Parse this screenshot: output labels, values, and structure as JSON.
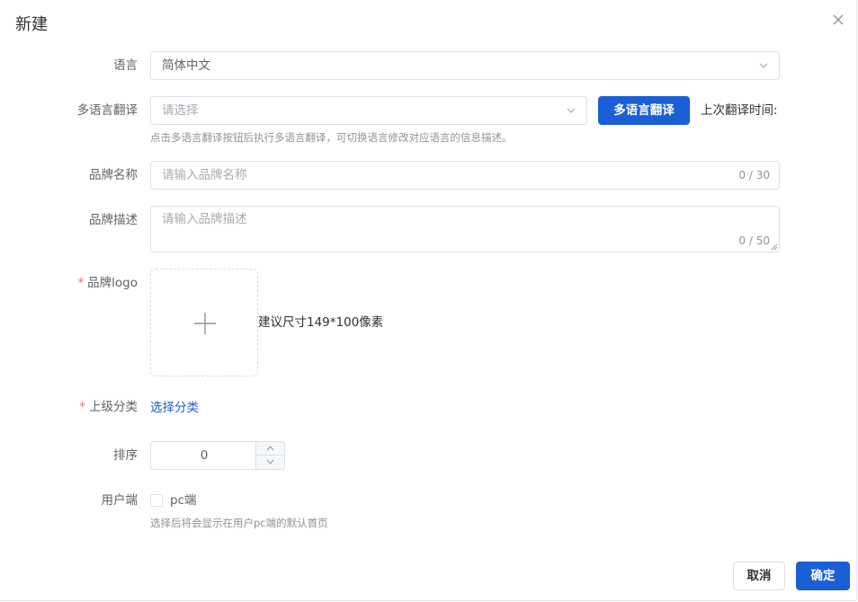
{
  "dialog": {
    "title": "新建"
  },
  "form": {
    "language": {
      "label": "语言",
      "value": "简体中文"
    },
    "translate": {
      "label": "多语言翻译",
      "placeholder": "请选择",
      "button_label": "多语言翻译",
      "last_time_label": "上次翻译时间:",
      "hint": "点击多语言翻译按钮后执行多语言翻译，可切换语言修改对应语言的信息描述。"
    },
    "brand_name": {
      "label": "品牌名称",
      "placeholder": "请输入品牌名称",
      "count": "0 / 30"
    },
    "brand_desc": {
      "label": "品牌描述",
      "placeholder": "请输入品牌描述",
      "count": "0 / 50"
    },
    "brand_logo": {
      "required_mark": "*",
      "label": "品牌logo",
      "hint": "建议尺寸149*100像素"
    },
    "parent_category": {
      "required_mark": "*",
      "label": "上级分类",
      "link_label": "选择分类"
    },
    "sort": {
      "label": "排序",
      "value": "0"
    },
    "client": {
      "label": "用户端",
      "checkbox_label": "pc端",
      "hint": "选择后将会显示在用户pc端的默认首页"
    }
  },
  "footer": {
    "cancel_label": "取消",
    "confirm_label": "确定"
  },
  "colors": {
    "primary": "#1a5fd6",
    "required": "#f56c6c",
    "border": "#dcdfe6"
  }
}
